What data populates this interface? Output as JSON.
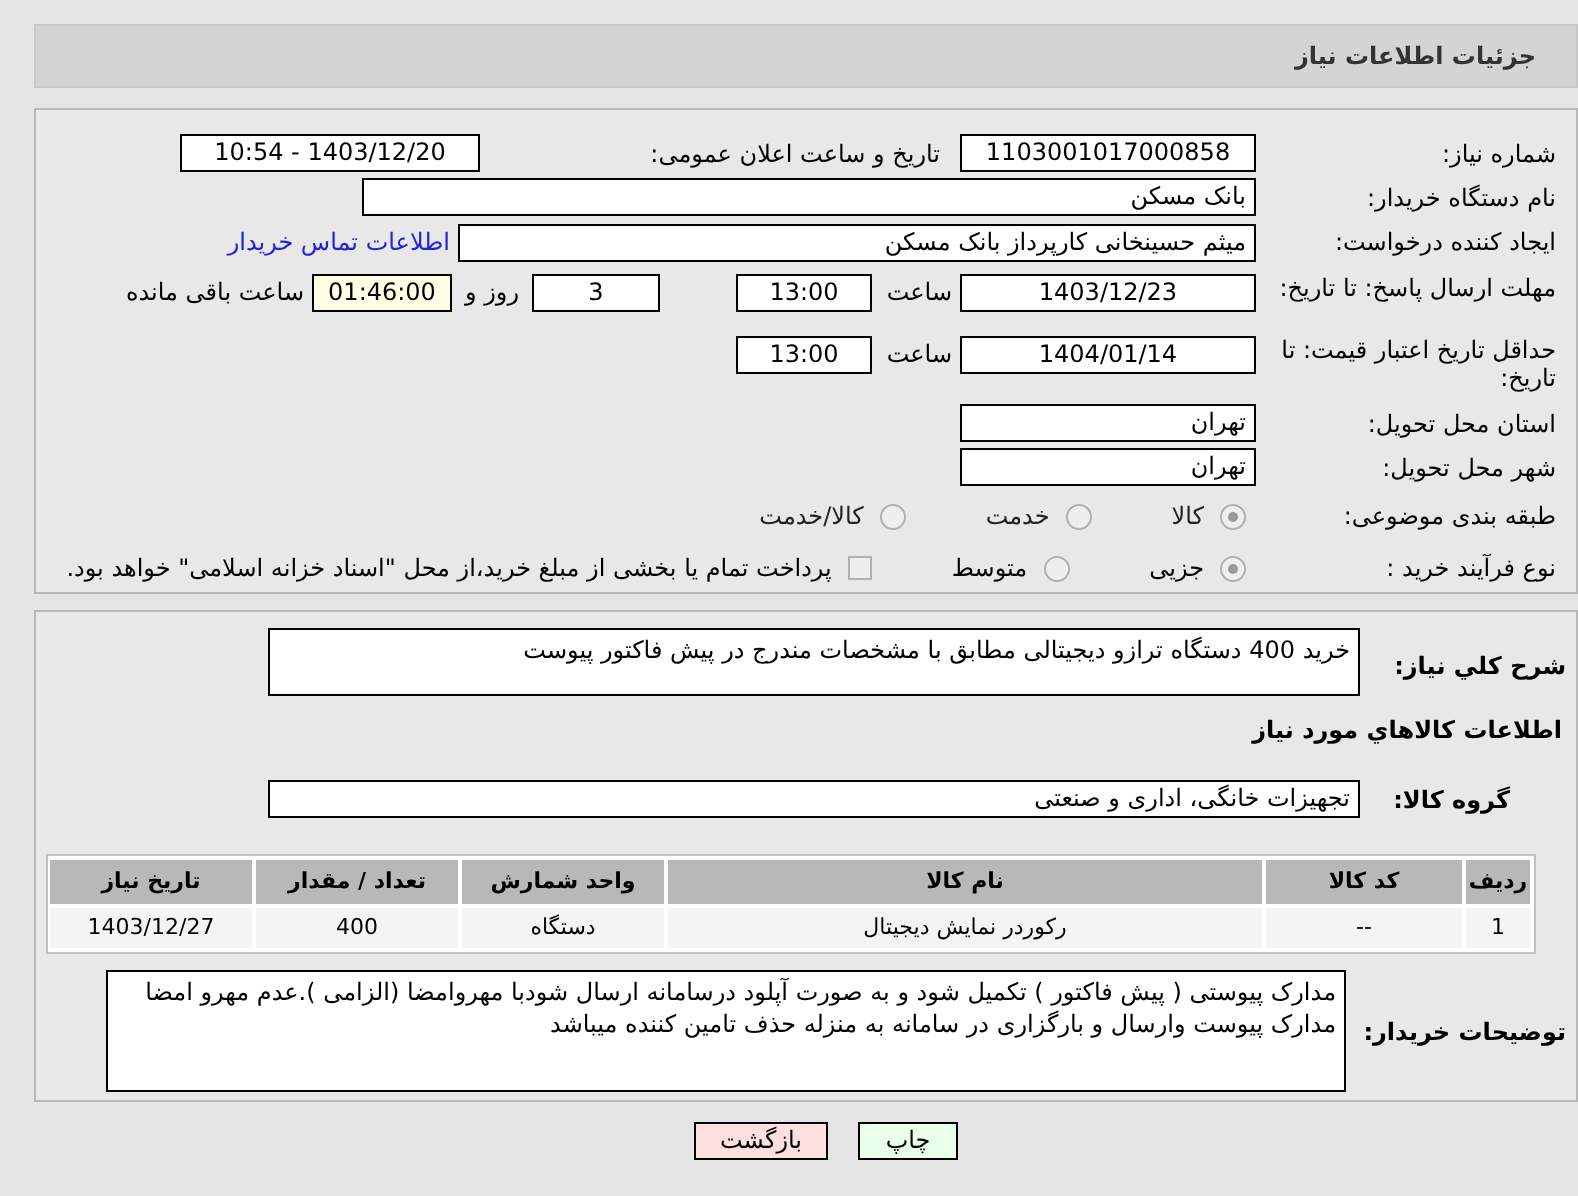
{
  "header": {
    "title": "جزئیات اطلاعات نیاز"
  },
  "need_number": {
    "label": "شماره نیاز:",
    "value": "1103001017000858"
  },
  "announce": {
    "label": "تاریخ و ساعت اعلان عمومی:",
    "value": "1403/12/20 - 10:54"
  },
  "buyer_org": {
    "label": "نام دستگاه خریدار:",
    "value": "بانک مسکن"
  },
  "requester": {
    "label": "ایجاد کننده درخواست:",
    "value": "میثم حسینخانی کارپرداز بانک مسکن",
    "link": "اطلاعات تماس خریدار"
  },
  "deadline": {
    "label": "مهلت ارسال پاسخ: تا تاریخ:",
    "date": "1403/12/23",
    "time_label": "ساعت",
    "time": "13:00",
    "days": "3",
    "days_label": "روز و",
    "remaining": "01:46:00",
    "remaining_label": "ساعت باقی مانده"
  },
  "validity": {
    "label": "حداقل تاریخ اعتبار قیمت: تا تاریخ:",
    "date": "1404/01/14",
    "time_label": "ساعت",
    "time": "13:00"
  },
  "province": {
    "label": "استان محل تحویل:",
    "value": "تهران"
  },
  "city": {
    "label": "شهر محل تحویل:",
    "value": "تهران"
  },
  "category": {
    "label": "طبقه بندی موضوعی:",
    "options": [
      {
        "label": "کالا",
        "selected": true
      },
      {
        "label": "خدمت",
        "selected": false
      },
      {
        "label": "کالا/خدمت",
        "selected": false
      }
    ]
  },
  "process": {
    "label": "نوع فرآیند خرید :",
    "options": [
      {
        "label": "جزیی",
        "selected": true
      },
      {
        "label": "متوسط",
        "selected": false
      }
    ],
    "treasury": {
      "label": "پرداخت تمام یا بخشی از مبلغ خرید،از محل \"اسناد خزانه اسلامی\" خواهد بود.",
      "checked": false
    }
  },
  "description": {
    "label": "شرح کلي نياز:",
    "value": "خرید 400 دستگاه ترازو دیجیتالی مطابق با مشخصات مندرج در پیش فاکتور پیوست"
  },
  "goods_title": "اطلاعات کالاهاي مورد نياز",
  "goods_group": {
    "label": "گروه کالا:",
    "value": "تجهیزات خانگی، اداری و صنعتی"
  },
  "table": {
    "columns": [
      "رديف",
      "کد کالا",
      "نام کالا",
      "واحد شمارش",
      "تعداد / مقدار",
      "تاریخ نیاز"
    ],
    "rows": [
      [
        "1",
        "--",
        "رکوردر نمایش دیجیتال",
        "دستگاه",
        "400",
        "1403/12/27"
      ]
    ]
  },
  "remarks": {
    "label": "توضیحات خریدار:",
    "value": "مدارک پیوستی ( پیش فاکتور ) تکمیل شود و به صورت آپلود درسامانه ارسال شودبا مهروامضا (الزامی ).عدم مهرو امضا مدارک پیوست وارسال و بارگزاری در سامانه به منزله حذف تامین کننده میباشد"
  },
  "buttons": [
    {
      "label": "چاپ",
      "kind": "print"
    },
    {
      "label": "بازگشت",
      "kind": "back"
    }
  ]
}
